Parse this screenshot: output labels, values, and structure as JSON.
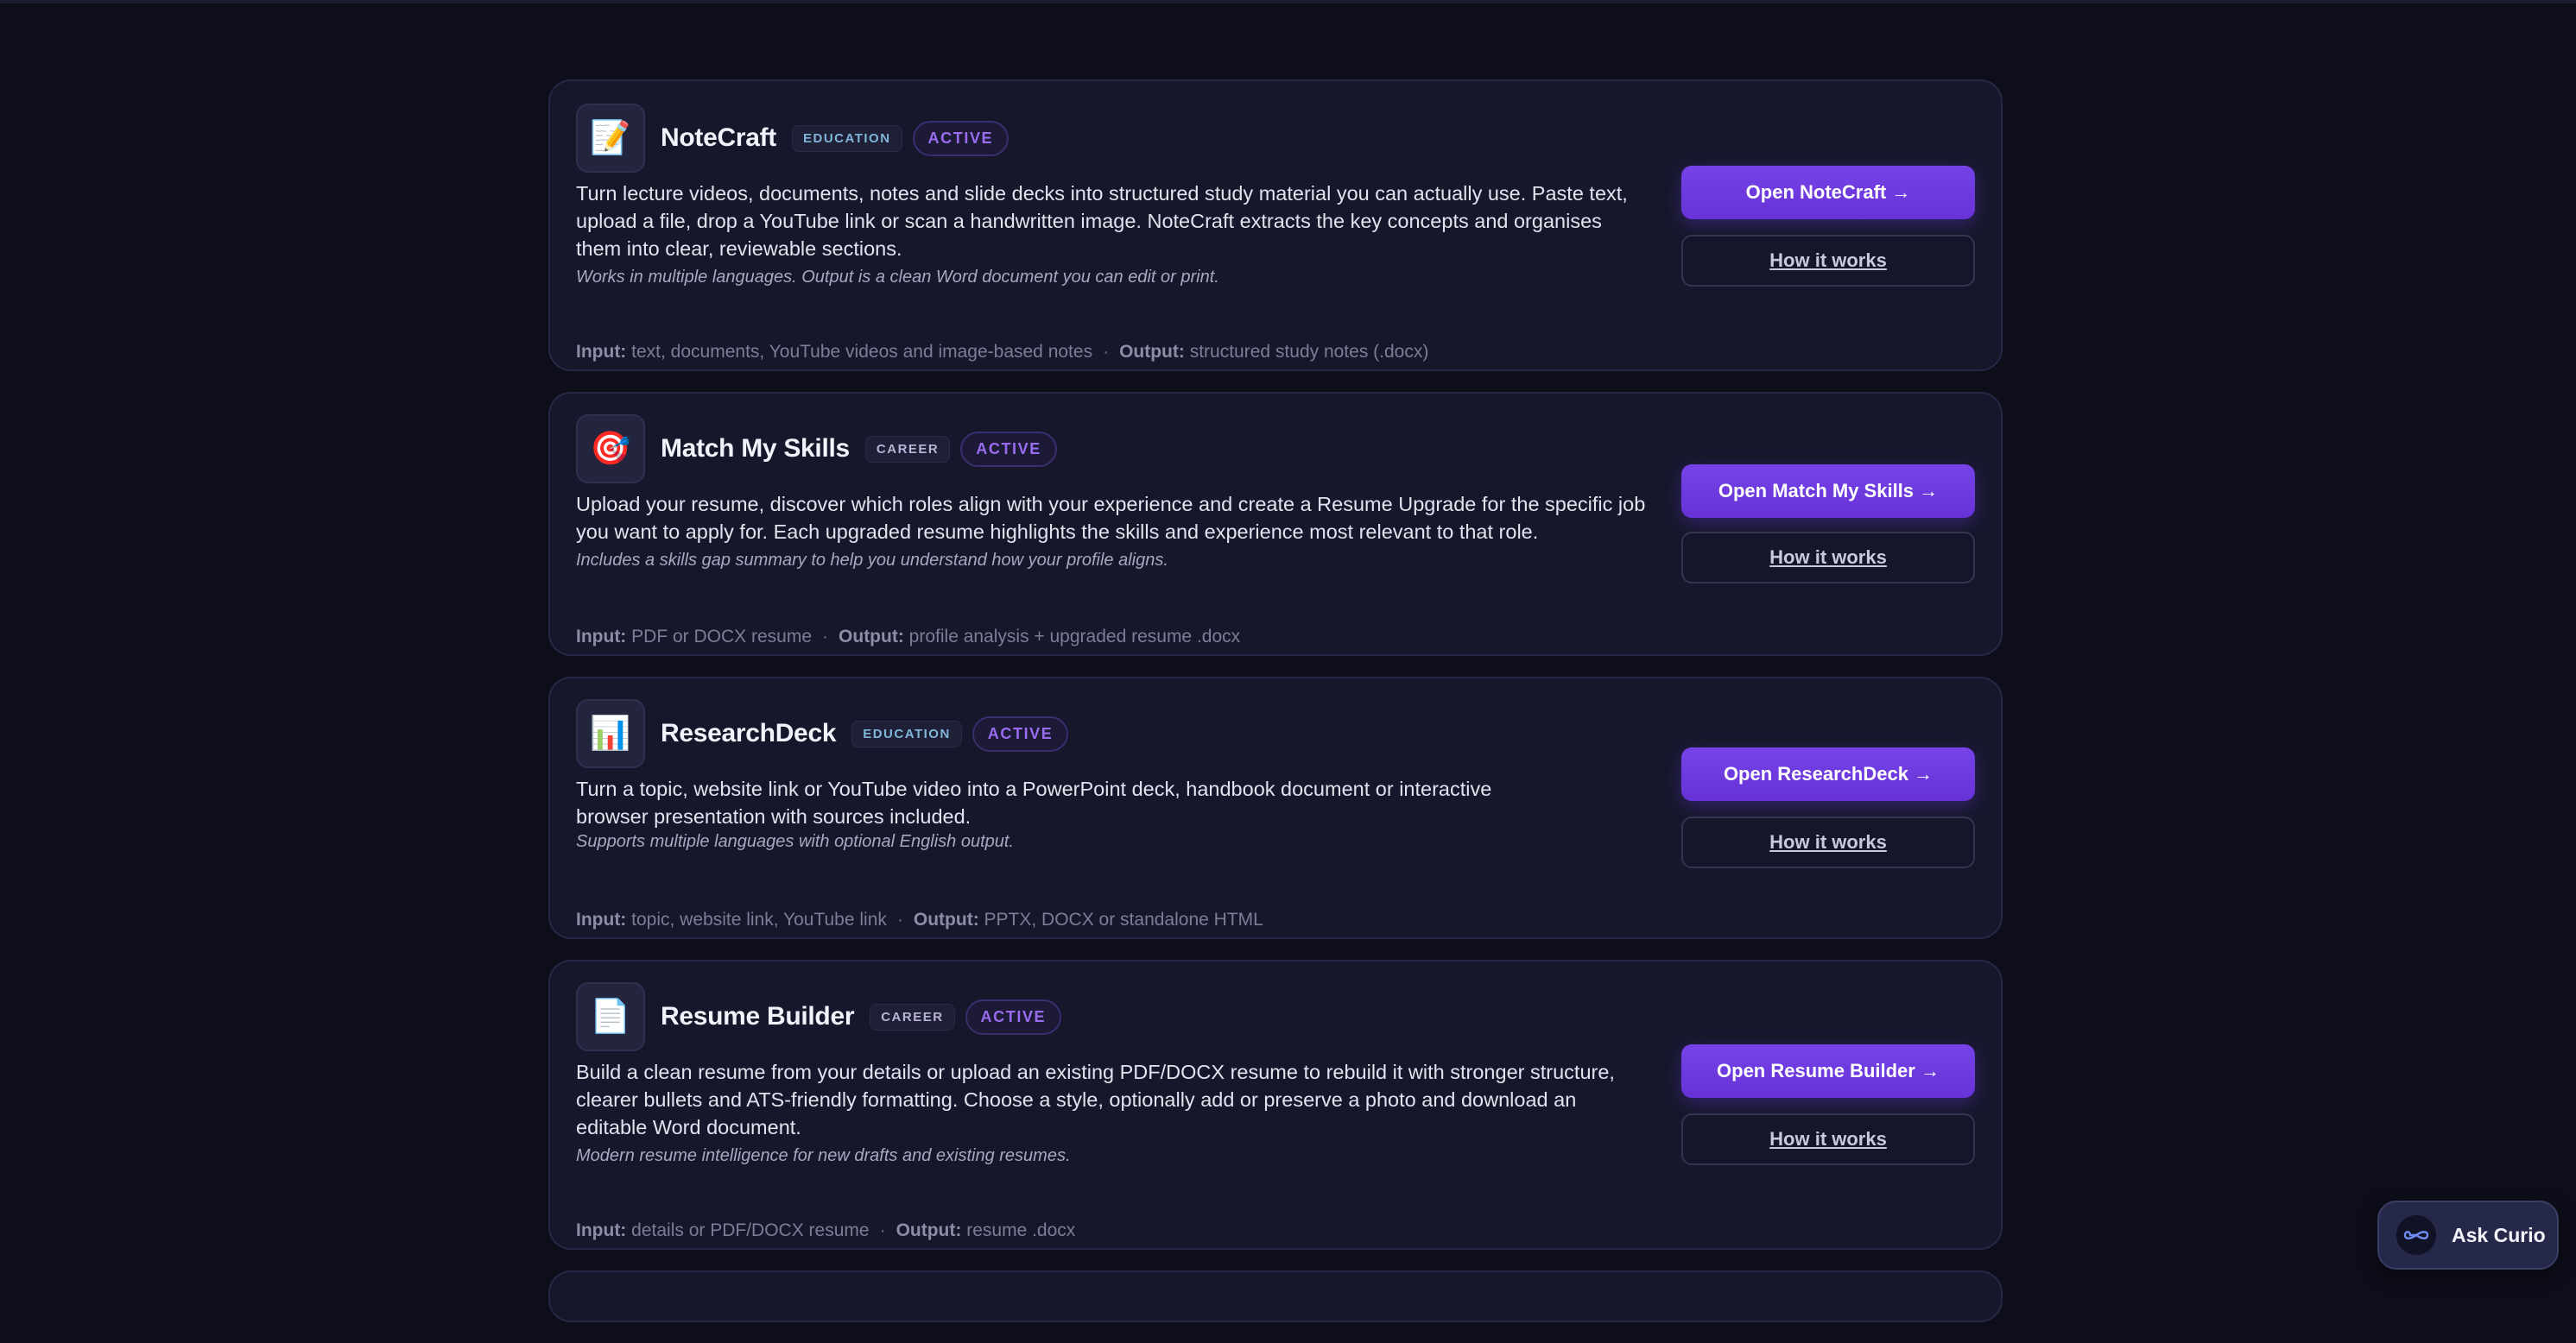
{
  "cards": [
    {
      "icon": "memo-icon",
      "icon_glyph": "📝",
      "name": "NoteCraft",
      "category": "EDUCATION",
      "status": "ACTIVE",
      "description": "Turn lecture videos, documents, notes and slide decks into structured study material you can actually use. Paste text, upload a file, drop a YouTube link or scan a handwritten image. NoteCraft extracts the key concepts and organises them into clear, reviewable sections.",
      "note": "Works in multiple languages. Output is a clean Word document you can edit or print.",
      "input_label": "Input:",
      "input": "text, documents, YouTube videos and image-based notes",
      "output_label": "Output:",
      "output": "structured study notes (.docx)",
      "open_label": "Open NoteCraft →",
      "how_label": "How it works"
    },
    {
      "icon": "target-icon",
      "icon_glyph": "🎯",
      "name": "Match My Skills",
      "category": "CAREER",
      "status": "ACTIVE",
      "description": "Upload your resume, discover which roles align with your experience and create a Resume Upgrade for the specific job you want to apply for. Each upgraded resume highlights the skills and experience most relevant to that role.",
      "note": "Includes a skills gap summary to help you understand how your profile aligns.",
      "input_label": "Input:",
      "input": "PDF or DOCX resume",
      "output_label": "Output:",
      "output": "profile analysis + upgraded resume .docx",
      "open_label": "Open Match My Skills →",
      "how_label": "How it works"
    },
    {
      "icon": "bar-chart-icon",
      "icon_glyph": "📊",
      "name": "ResearchDeck",
      "category": "EDUCATION",
      "status": "ACTIVE",
      "description": "Turn a topic, website link or YouTube video into a PowerPoint deck, handbook document or interactive browser presentation with sources included.",
      "note": "Supports multiple languages with optional English output.",
      "input_label": "Input:",
      "input": "topic, website link, YouTube link",
      "output_label": "Output:",
      "output": "PPTX, DOCX or standalone HTML",
      "open_label": "Open ResearchDeck →",
      "how_label": "How it works"
    },
    {
      "icon": "document-icon",
      "icon_glyph": "📄",
      "name": "Resume Builder",
      "category": "CAREER",
      "status": "ACTIVE",
      "description": "Build a clean resume from your details or upload an existing PDF/DOCX resume to rebuild it with stronger structure, clearer bullets and ATS-friendly formatting. Choose a style, optionally add or preserve a photo and download an editable Word document.",
      "note": "Modern resume intelligence for new drafts and existing resumes.",
      "input_label": "Input:",
      "input": "details or PDF/DOCX resume",
      "output_label": "Output:",
      "output": "resume .docx",
      "open_label": "Open Resume Builder →",
      "how_label": "How it works"
    }
  ],
  "assistant": {
    "label": "Ask Curio",
    "icon": "infinity-icon"
  },
  "colors": {
    "background": "#0d0e1a",
    "card": "#16172b",
    "accent": "#6f3ae0",
    "status": "#9a6cf0"
  }
}
